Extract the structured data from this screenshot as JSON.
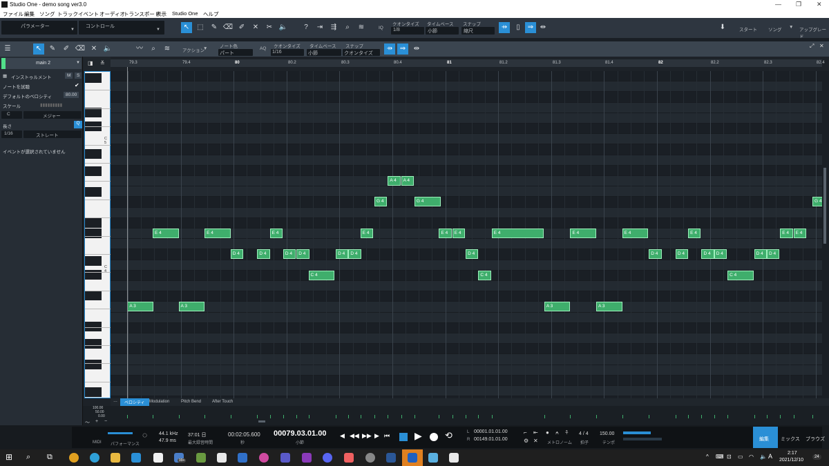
{
  "app": {
    "title": "Studio One - demo song ver3.0"
  },
  "menu": [
    "ファイル",
    "編集",
    "ソング",
    "トラック",
    "イベント",
    "オーディオ",
    "トランスポート",
    "表示",
    "Studio One",
    "ヘルプ"
  ],
  "toolbar": {
    "param": "パラメーター",
    "control": "コントロール",
    "quantize_label": "クオンタイズ",
    "quantize_value": "1/8",
    "timebase_label": "タイムベース",
    "timebase_value": "小節",
    "snap_label": "スナップ",
    "snap_value": "縮尺",
    "iq": "IQ",
    "start": "スタート",
    "song": "ソング",
    "upgrade": "アップグレード"
  },
  "editor": {
    "action": "アクション",
    "notecolor_label": "ノート色",
    "notecolor_value": "パート",
    "aq": "AQ",
    "quantize_label": "クオンタイズ",
    "quantize_value": "1/16",
    "timebase_label": "タイムベース",
    "timebase_value": "小節",
    "snap_label": "スナップ",
    "snap_value": "クオンタイズ"
  },
  "inspector": {
    "track": "main 2",
    "instrument": "インストゥルメント",
    "m": "M",
    "s": "S",
    "audition": "ノートを試聴",
    "default_velocity_label": "デフォルトのベロシティ",
    "default_velocity_value": "80.00",
    "scale_label": "スケール",
    "scale_root": "C",
    "scale_type": "メジャー",
    "length_label": "長さ",
    "length_value": "1/16",
    "length_mode": "ストレート",
    "no_event": "イベントが選択されていません"
  },
  "piano": {
    "labels": [
      "C 5",
      "C 4"
    ]
  },
  "ruler": [
    "79.3",
    "79.4",
    "80",
    "80.2",
    "80.3",
    "80.4",
    "81",
    "81.2",
    "81.3",
    "81.4",
    "82",
    "82.2",
    "82.3",
    "82.4"
  ],
  "notes": [
    {
      "label": "A 4",
      "pitch": "A4",
      "start": 0.395,
      "len": 0.018
    },
    {
      "label": "A 4",
      "pitch": "A4",
      "start": 0.414,
      "len": 0.018
    },
    {
      "label": "G 4",
      "pitch": "G4",
      "start": 0.376,
      "len": 0.018
    },
    {
      "label": "G 4",
      "pitch": "G4",
      "start": 0.433,
      "len": 0.037
    },
    {
      "label": "G 4",
      "pitch": "G4",
      "start": 1.0,
      "len": 0.018
    },
    {
      "label": "E 4",
      "pitch": "E4",
      "start": 0.06,
      "len": 0.037
    },
    {
      "label": "E 4",
      "pitch": "E4",
      "start": 0.134,
      "len": 0.037
    },
    {
      "label": "E 4",
      "pitch": "E4",
      "start": 0.227,
      "len": 0.018
    },
    {
      "label": "E 4",
      "pitch": "E4",
      "start": 0.356,
      "len": 0.018
    },
    {
      "label": "E 4",
      "pitch": "E4",
      "start": 0.468,
      "len": 0.018
    },
    {
      "label": "E 4",
      "pitch": "E4",
      "start": 0.487,
      "len": 0.018
    },
    {
      "label": "E 4",
      "pitch": "E4",
      "start": 0.543,
      "len": 0.074
    },
    {
      "label": "E 4",
      "pitch": "E4",
      "start": 0.655,
      "len": 0.037
    },
    {
      "label": "E 4",
      "pitch": "E4",
      "start": 0.729,
      "len": 0.037
    },
    {
      "label": "E 4",
      "pitch": "E4",
      "start": 0.823,
      "len": 0.018
    },
    {
      "label": "E 4",
      "pitch": "E4",
      "start": 0.954,
      "len": 0.018
    },
    {
      "label": "E 4",
      "pitch": "E4",
      "start": 0.973,
      "len": 0.018
    },
    {
      "label": "D 4",
      "pitch": "D4",
      "start": 0.171,
      "len": 0.018
    },
    {
      "label": "D 4",
      "pitch": "D4",
      "start": 0.209,
      "len": 0.018
    },
    {
      "label": "D 4",
      "pitch": "D4",
      "start": 0.246,
      "len": 0.018
    },
    {
      "label": "D 4",
      "pitch": "D4",
      "start": 0.265,
      "len": 0.018
    },
    {
      "label": "D 4",
      "pitch": "D4",
      "start": 0.321,
      "len": 0.018
    },
    {
      "label": "D 4",
      "pitch": "D4",
      "start": 0.339,
      "len": 0.018
    },
    {
      "label": "D 4",
      "pitch": "D4",
      "start": 0.506,
      "len": 0.018
    },
    {
      "label": "D 4",
      "pitch": "D4",
      "start": 0.767,
      "len": 0.018
    },
    {
      "label": "D 4",
      "pitch": "D4",
      "start": 0.805,
      "len": 0.018
    },
    {
      "label": "D 4",
      "pitch": "D4",
      "start": 0.842,
      "len": 0.018
    },
    {
      "label": "D 4",
      "pitch": "D4",
      "start": 0.86,
      "len": 0.018
    },
    {
      "label": "D 4",
      "pitch": "D4",
      "start": 0.917,
      "len": 0.018
    },
    {
      "label": "D 4",
      "pitch": "D4",
      "start": 0.935,
      "len": 0.018
    },
    {
      "label": "C 4",
      "pitch": "C4",
      "start": 0.282,
      "len": 0.037
    },
    {
      "label": "C 4",
      "pitch": "C4",
      "start": 0.524,
      "len": 0.018
    },
    {
      "label": "C 4",
      "pitch": "C4",
      "start": 0.879,
      "len": 0.037
    },
    {
      "label": "A 3",
      "pitch": "A3",
      "start": 0.024,
      "len": 0.037
    },
    {
      "label": "A 3",
      "pitch": "A3",
      "start": 0.097,
      "len": 0.037
    },
    {
      "label": "A 3",
      "pitch": "A3",
      "start": 0.618,
      "len": 0.037
    },
    {
      "label": "A 3",
      "pitch": "A3",
      "start": 0.692,
      "len": 0.037
    }
  ],
  "lanes": {
    "velocity": "ベロシティ",
    "modulation": "Modulation",
    "pitchbend": "Pitch Bend",
    "aftertouch": "After Touch",
    "scale_top": "100.00",
    "scale_mid": "50.00",
    "scale_bot": "0.00"
  },
  "transport": {
    "midi": "MIDI",
    "performance": "パフォーマンス",
    "samplerate": "44.1 kHz",
    "latency": "47.9 ms",
    "rec_time": "37:01 日",
    "rec_label": "最大録音時間",
    "seconds": "00:02:05.600",
    "seconds_label": "秒",
    "bars": "00079.03.01.00",
    "bars_label": "小節",
    "loop_l": "00001.01.01.00",
    "loop_r": "00149.01.01.00",
    "l": "L",
    "r": "R",
    "metronome": "メトロノーム",
    "timesig": "4 / 4",
    "timesig_label": "拍子",
    "tempo": "150.00",
    "tempo_label": "テンポ"
  },
  "bottomtabs": {
    "edit": "編集",
    "mix": "ミックス",
    "browse": "ブラウズ"
  },
  "taskbar": {
    "time": "2:17",
    "date": "2021/12/10",
    "badge": "99+",
    "notif": "24",
    "lang": "A"
  }
}
